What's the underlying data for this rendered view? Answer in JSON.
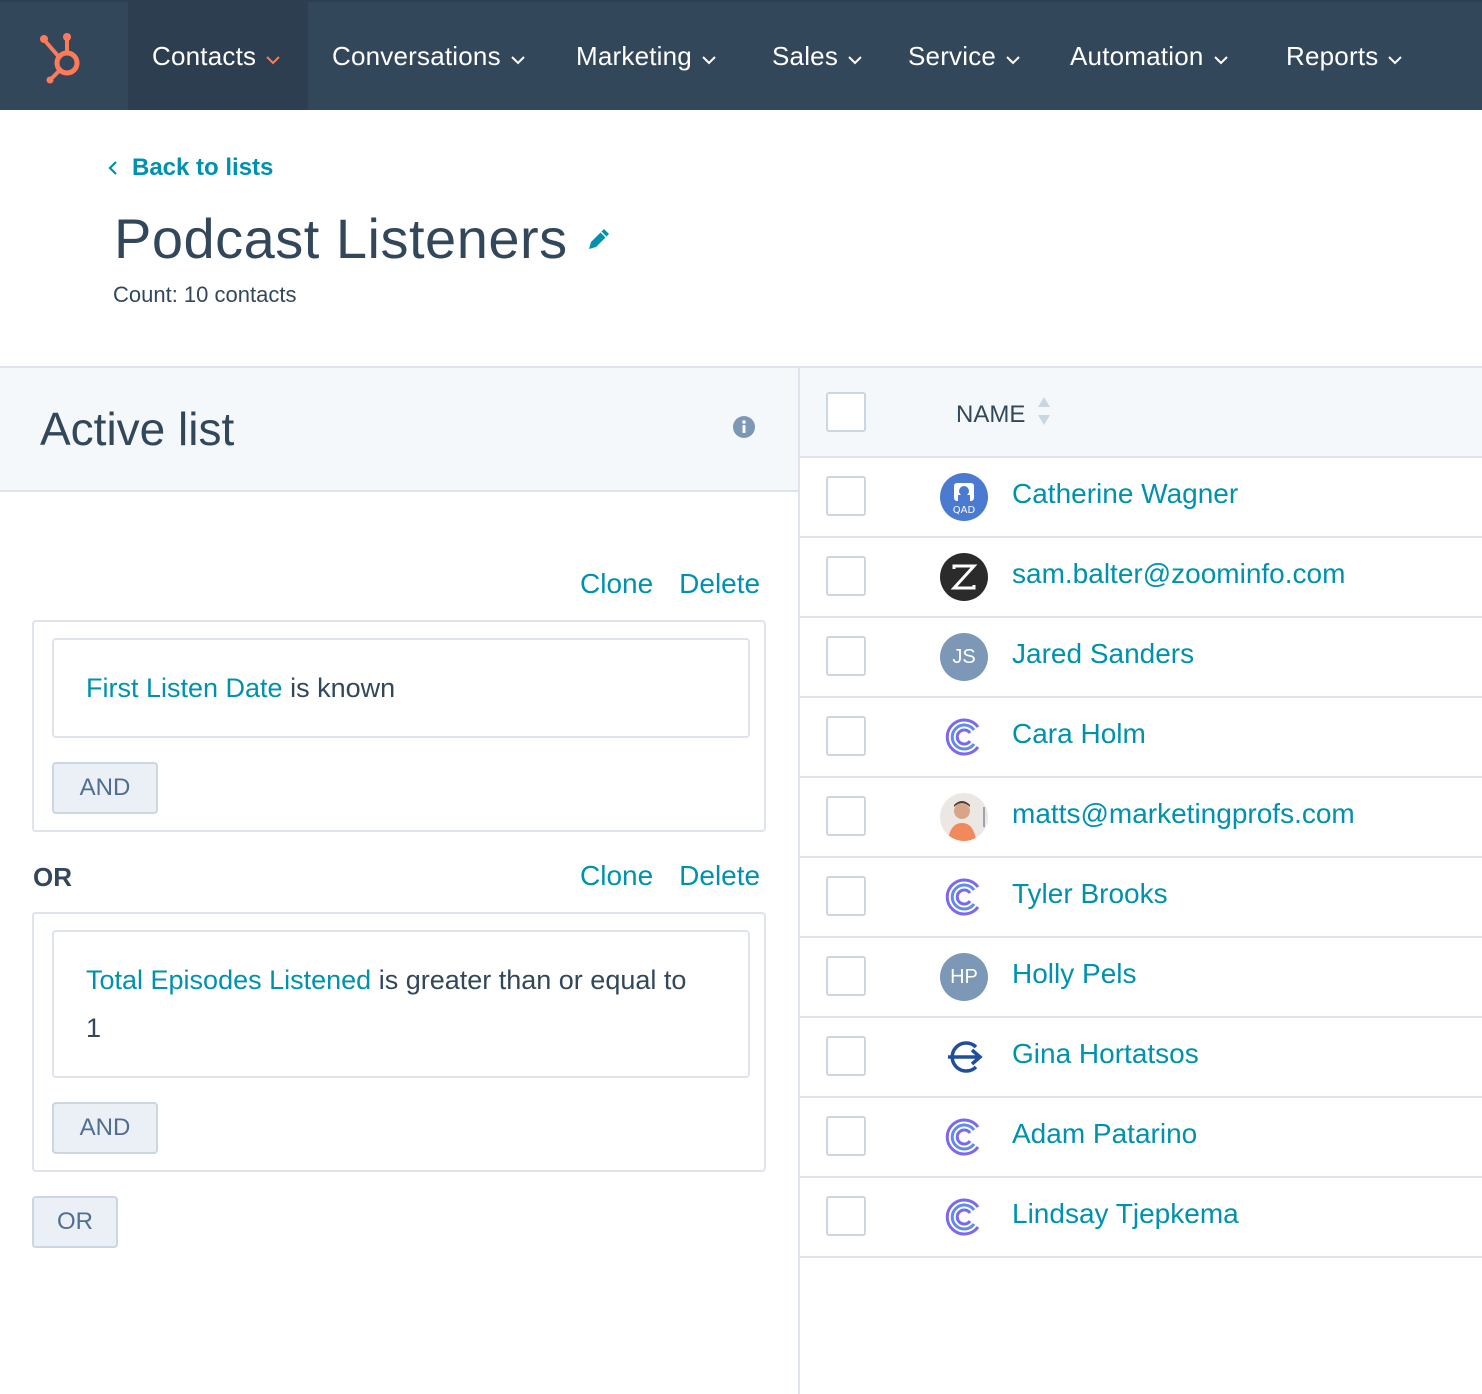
{
  "nav": {
    "items": [
      {
        "label": "Contacts",
        "active": true
      },
      {
        "label": "Conversations"
      },
      {
        "label": "Marketing"
      },
      {
        "label": "Sales"
      },
      {
        "label": "Service"
      },
      {
        "label": "Automation"
      },
      {
        "label": "Reports"
      }
    ]
  },
  "header": {
    "back_label": "Back to lists",
    "title": "Podcast Listeners",
    "count": "Count: 10 contacts"
  },
  "filters": {
    "panel_title": "Active list",
    "clone_label": "Clone",
    "delete_label": "Delete",
    "or_separator": "OR",
    "and_button": "AND",
    "or_button": "OR",
    "groups": [
      {
        "property": "First Listen Date",
        "condition": " is known",
        "value": ""
      },
      {
        "property": "Total Episodes Listened",
        "condition": " is greater than or equal to",
        "value": "1"
      }
    ]
  },
  "table": {
    "column_name": "NAME",
    "rows": [
      {
        "name": "Catherine Wagner",
        "avatar": "qad-logo-icon"
      },
      {
        "name": "sam.balter@zoominfo.com",
        "avatar": "zoominfo-logo-icon"
      },
      {
        "name": "Jared Sanders",
        "avatar": "initials",
        "initials": "JS"
      },
      {
        "name": "Cara Holm",
        "avatar": "company-c-logo-icon"
      },
      {
        "name": "matts@marketingprofs.com",
        "avatar": "person-photo"
      },
      {
        "name": "Tyler Brooks",
        "avatar": "company-c-logo-icon"
      },
      {
        "name": "Holly Pels",
        "avatar": "initials",
        "initials": "HP"
      },
      {
        "name": "Gina Hortatsos",
        "avatar": "arrow-e-logo-icon"
      },
      {
        "name": "Adam Patarino",
        "avatar": "company-c-logo-icon"
      },
      {
        "name": "Lindsay Tjepkema",
        "avatar": "company-c-logo-icon"
      }
    ]
  },
  "colors": {
    "nav_bg": "#33475b",
    "link": "#0091ae",
    "hubspot_orange": "#ff7a59",
    "text": "#33475b"
  }
}
